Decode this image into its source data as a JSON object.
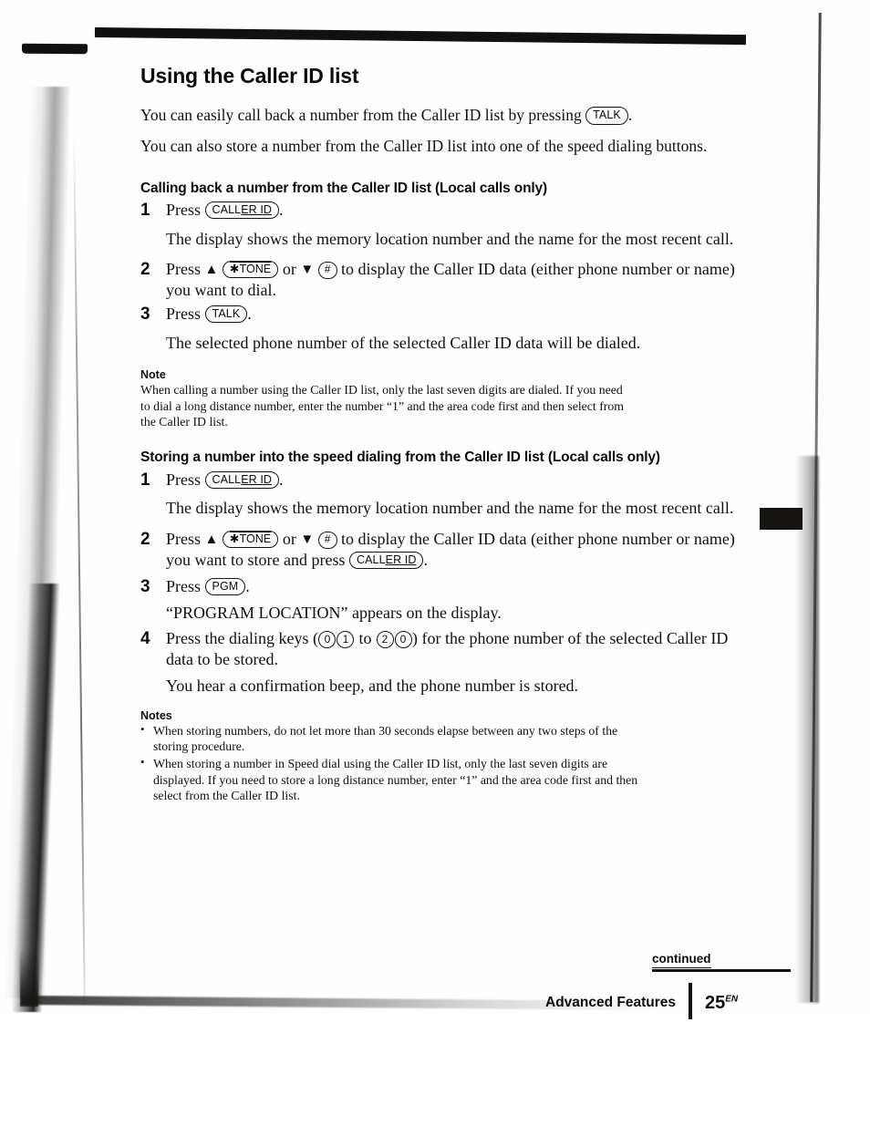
{
  "page": {
    "title": "Using the Caller ID list",
    "intro_1_prefix": "You can easily call back a number from the Caller ID list by pressing ",
    "intro_1_key": "TALK",
    "intro_1_suffix": ".",
    "intro_2": "You can also store a number from the Caller ID list into one of the speed dialing buttons."
  },
  "section_calling": {
    "heading": "Calling back a number from the Caller ID list (Local calls only)",
    "step1_num": "1",
    "step1_prefix": "Press ",
    "step1_key": "CALLER ID",
    "step1_key_plain": "CALL",
    "step1_key_underline": "ER ID",
    "step1_suffix": ".",
    "step1_body": "The display shows the memory location number and the name for the most recent call.",
    "step2_num": "2",
    "step2_prefix": "Press ",
    "step2_up_arrow": "▲",
    "step2_key_tone": "✱TONE",
    "step2_or": " or ",
    "step2_down_arrow": "▼",
    "step2_key_hash": "#",
    "step2_text": " to display the Caller ID data (either phone number or name) you want to dial.",
    "step3_num": "3",
    "step3_prefix": "Press ",
    "step3_key": "TALK",
    "step3_suffix": ".",
    "step3_body": "The selected phone number of the selected Caller ID data will be dialed."
  },
  "note_calling": {
    "heading": "Note",
    "body": "When calling a number using the Caller ID list, only the last seven digits are dialed. If you need to dial a long distance number, enter the number “1” and the area code first and then select from the Caller ID list."
  },
  "section_storing": {
    "heading": "Storing a number into the speed dialing from the Caller ID list (Local calls only)",
    "step1_num": "1",
    "step1_prefix": "Press ",
    "step1_key_plain": "CALL",
    "step1_key_underline": "ER ID",
    "step1_suffix": ".",
    "step1_body": "The display shows the memory location number and the name for the most recent call.",
    "step2_num": "2",
    "step2_prefix": "Press ",
    "step2_up_arrow": "▲",
    "step2_key_tone": "✱TONE",
    "step2_or": " or ",
    "step2_down_arrow": "▼",
    "step2_key_hash": "#",
    "step2_text": " to display the Caller ID data (either phone number or name) you want to store and press ",
    "step2_key_callerid_plain": "CALL",
    "step2_key_callerid_underline": "ER ID",
    "step2_end": ".",
    "step3_num": "3",
    "step3_prefix": "Press ",
    "step3_key": "PGM",
    "step3_suffix": ".",
    "step3_body": "“PROGRAM LOCATION” appears on the display.",
    "step4_num": "4",
    "step4_prefix": "Press the dialing keys (",
    "step4_d1": "0",
    "step4_d2": "1",
    "step4_to": " to ",
    "step4_d3": "2",
    "step4_d4": "0",
    "step4_suffix": ") for the phone number of the selected Caller ID data to be stored.",
    "step4_body": "You hear a confirmation beep, and the phone number is stored."
  },
  "notes_storing": {
    "heading": "Notes",
    "items": [
      "When storing numbers, do not let more than 30 seconds elapse between any two steps of the storing procedure.",
      "When storing a number in Speed dial using the Caller ID list, only the last seven digits are displayed. If you need to store a long distance number, enter “1” and the area code first and then select from the Caller ID list."
    ]
  },
  "side_tab": {
    "label": "Advanced Features"
  },
  "footer": {
    "continued": "continued",
    "section": "Advanced Features",
    "page_number": "25",
    "page_suffix": "EN"
  }
}
